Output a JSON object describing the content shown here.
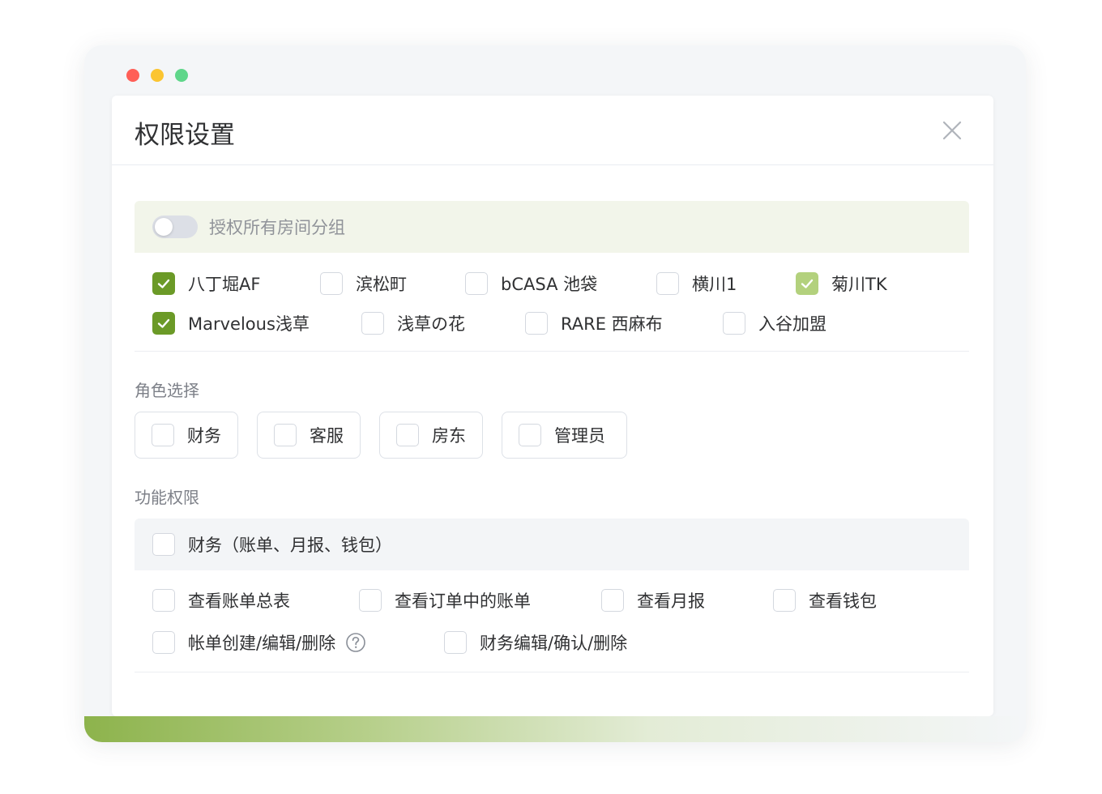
{
  "dialog": {
    "title": "权限设置"
  },
  "rooms": {
    "toggle_label": "授权所有房间分组",
    "items": [
      {
        "label": "八丁堀AF",
        "state": "checked"
      },
      {
        "label": "滨松町",
        "state": "unchecked"
      },
      {
        "label": "bCASA 池袋",
        "state": "unchecked"
      },
      {
        "label": "横川1",
        "state": "unchecked"
      },
      {
        "label": "菊川TK",
        "state": "checked-light"
      },
      {
        "label": "Marvelous浅草",
        "state": "checked"
      },
      {
        "label": "浅草の花",
        "state": "unchecked"
      },
      {
        "label": "RARE 西麻布",
        "state": "unchecked"
      },
      {
        "label": "入谷加盟",
        "state": "unchecked"
      }
    ]
  },
  "roles": {
    "title": "角色选择",
    "items": [
      {
        "label": "财务"
      },
      {
        "label": "客服"
      },
      {
        "label": "房东"
      },
      {
        "label": "管理员"
      }
    ]
  },
  "permissions": {
    "title": "功能权限",
    "group_label": "财务（账单、月报、钱包）",
    "items": [
      {
        "label": "查看账单总表"
      },
      {
        "label": "查看订单中的账单"
      },
      {
        "label": "查看月报"
      },
      {
        "label": "查看钱包"
      },
      {
        "label": "帐单创建/编辑/删除"
      },
      {
        "label": "财务编辑/确认/删除"
      }
    ]
  },
  "colors": {
    "accent": "#6b9a27",
    "accent_light": "#b3d17d",
    "dot_red": "#ff5f57",
    "dot_yellow": "#fbc531",
    "dot_green": "#5fd68a"
  }
}
